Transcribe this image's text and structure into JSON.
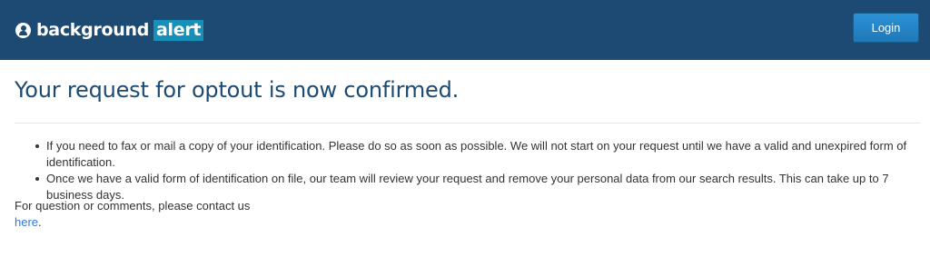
{
  "header": {
    "brand_word1": "background",
    "brand_word2": "alert",
    "login_label": "Login",
    "colors": {
      "navbar": "#1d4a72",
      "brand_accent": "#1690b8",
      "button": "#1f78b8"
    },
    "logo_icon": "person-pin-icon"
  },
  "main": {
    "title": "Your request for optout is now confirmed.",
    "bullets": [
      "If you need to fax or mail a copy of your identification. Please do so as soon as possible. We will not start on your request until we have a valid and unexpired form of identification.",
      "Once we have a valid form of identification on file, our team will review your request and remove your personal data from our search results. This can take up to 7 business days."
    ],
    "contact_text": "For question or comments, please contact us",
    "contact_link": "here",
    "contact_period": "."
  }
}
